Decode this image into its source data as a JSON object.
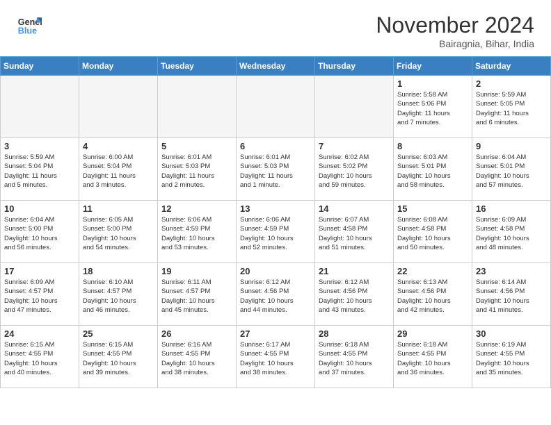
{
  "header": {
    "logo_line1": "General",
    "logo_line2": "Blue",
    "month_title": "November 2024",
    "location": "Bairagnia, Bihar, India"
  },
  "weekdays": [
    "Sunday",
    "Monday",
    "Tuesday",
    "Wednesday",
    "Thursday",
    "Friday",
    "Saturday"
  ],
  "weeks": [
    [
      {
        "day": "",
        "info": ""
      },
      {
        "day": "",
        "info": ""
      },
      {
        "day": "",
        "info": ""
      },
      {
        "day": "",
        "info": ""
      },
      {
        "day": "",
        "info": ""
      },
      {
        "day": "1",
        "info": "Sunrise: 5:58 AM\nSunset: 5:06 PM\nDaylight: 11 hours\nand 7 minutes."
      },
      {
        "day": "2",
        "info": "Sunrise: 5:59 AM\nSunset: 5:05 PM\nDaylight: 11 hours\nand 6 minutes."
      }
    ],
    [
      {
        "day": "3",
        "info": "Sunrise: 5:59 AM\nSunset: 5:04 PM\nDaylight: 11 hours\nand 5 minutes."
      },
      {
        "day": "4",
        "info": "Sunrise: 6:00 AM\nSunset: 5:04 PM\nDaylight: 11 hours\nand 3 minutes."
      },
      {
        "day": "5",
        "info": "Sunrise: 6:01 AM\nSunset: 5:03 PM\nDaylight: 11 hours\nand 2 minutes."
      },
      {
        "day": "6",
        "info": "Sunrise: 6:01 AM\nSunset: 5:03 PM\nDaylight: 11 hours\nand 1 minute."
      },
      {
        "day": "7",
        "info": "Sunrise: 6:02 AM\nSunset: 5:02 PM\nDaylight: 10 hours\nand 59 minutes."
      },
      {
        "day": "8",
        "info": "Sunrise: 6:03 AM\nSunset: 5:01 PM\nDaylight: 10 hours\nand 58 minutes."
      },
      {
        "day": "9",
        "info": "Sunrise: 6:04 AM\nSunset: 5:01 PM\nDaylight: 10 hours\nand 57 minutes."
      }
    ],
    [
      {
        "day": "10",
        "info": "Sunrise: 6:04 AM\nSunset: 5:00 PM\nDaylight: 10 hours\nand 56 minutes."
      },
      {
        "day": "11",
        "info": "Sunrise: 6:05 AM\nSunset: 5:00 PM\nDaylight: 10 hours\nand 54 minutes."
      },
      {
        "day": "12",
        "info": "Sunrise: 6:06 AM\nSunset: 4:59 PM\nDaylight: 10 hours\nand 53 minutes."
      },
      {
        "day": "13",
        "info": "Sunrise: 6:06 AM\nSunset: 4:59 PM\nDaylight: 10 hours\nand 52 minutes."
      },
      {
        "day": "14",
        "info": "Sunrise: 6:07 AM\nSunset: 4:58 PM\nDaylight: 10 hours\nand 51 minutes."
      },
      {
        "day": "15",
        "info": "Sunrise: 6:08 AM\nSunset: 4:58 PM\nDaylight: 10 hours\nand 50 minutes."
      },
      {
        "day": "16",
        "info": "Sunrise: 6:09 AM\nSunset: 4:58 PM\nDaylight: 10 hours\nand 48 minutes."
      }
    ],
    [
      {
        "day": "17",
        "info": "Sunrise: 6:09 AM\nSunset: 4:57 PM\nDaylight: 10 hours\nand 47 minutes."
      },
      {
        "day": "18",
        "info": "Sunrise: 6:10 AM\nSunset: 4:57 PM\nDaylight: 10 hours\nand 46 minutes."
      },
      {
        "day": "19",
        "info": "Sunrise: 6:11 AM\nSunset: 4:57 PM\nDaylight: 10 hours\nand 45 minutes."
      },
      {
        "day": "20",
        "info": "Sunrise: 6:12 AM\nSunset: 4:56 PM\nDaylight: 10 hours\nand 44 minutes."
      },
      {
        "day": "21",
        "info": "Sunrise: 6:12 AM\nSunset: 4:56 PM\nDaylight: 10 hours\nand 43 minutes."
      },
      {
        "day": "22",
        "info": "Sunrise: 6:13 AM\nSunset: 4:56 PM\nDaylight: 10 hours\nand 42 minutes."
      },
      {
        "day": "23",
        "info": "Sunrise: 6:14 AM\nSunset: 4:56 PM\nDaylight: 10 hours\nand 41 minutes."
      }
    ],
    [
      {
        "day": "24",
        "info": "Sunrise: 6:15 AM\nSunset: 4:55 PM\nDaylight: 10 hours\nand 40 minutes."
      },
      {
        "day": "25",
        "info": "Sunrise: 6:15 AM\nSunset: 4:55 PM\nDaylight: 10 hours\nand 39 minutes."
      },
      {
        "day": "26",
        "info": "Sunrise: 6:16 AM\nSunset: 4:55 PM\nDaylight: 10 hours\nand 38 minutes."
      },
      {
        "day": "27",
        "info": "Sunrise: 6:17 AM\nSunset: 4:55 PM\nDaylight: 10 hours\nand 38 minutes."
      },
      {
        "day": "28",
        "info": "Sunrise: 6:18 AM\nSunset: 4:55 PM\nDaylight: 10 hours\nand 37 minutes."
      },
      {
        "day": "29",
        "info": "Sunrise: 6:18 AM\nSunset: 4:55 PM\nDaylight: 10 hours\nand 36 minutes."
      },
      {
        "day": "30",
        "info": "Sunrise: 6:19 AM\nSunset: 4:55 PM\nDaylight: 10 hours\nand 35 minutes."
      }
    ]
  ]
}
